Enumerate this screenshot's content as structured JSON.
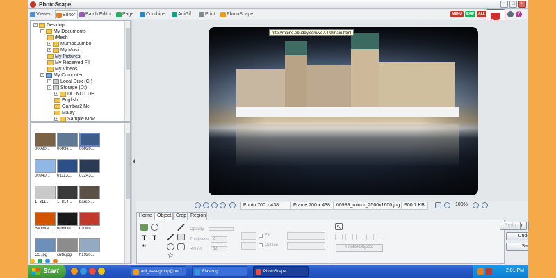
{
  "window": {
    "title": "PhotoScape"
  },
  "tabs": [
    {
      "label": "Viewer",
      "icon": "viewer-icon",
      "color": "#4f8fd6"
    },
    {
      "label": "Editor",
      "icon": "editor-icon",
      "color": "#e67e22",
      "active": true
    },
    {
      "label": "Batch Editor",
      "icon": "batch-editor-icon",
      "color": "#9b59b6"
    },
    {
      "label": "Page",
      "icon": "page-icon",
      "color": "#27ae60"
    },
    {
      "label": "Combine",
      "icon": "combine-icon",
      "color": "#2e86c1"
    },
    {
      "label": "AniGif",
      "icon": "anigif-icon",
      "color": "#16a085"
    },
    {
      "label": "Print",
      "icon": "print-icon",
      "color": "#7f8c8d"
    },
    {
      "label": "PhotoScape",
      "icon": "photoscape-icon",
      "color": "#f39c12"
    }
  ],
  "top_right_badges": [
    {
      "label": "MENU",
      "color": "#c0392b"
    },
    {
      "label": "EXIF",
      "color": "#27ae60"
    },
    {
      "label": "ALL",
      "color": "#c0392b"
    }
  ],
  "tooltip": "http://maine.ebuddy.com/vo7.4.9/main.html",
  "tree": [
    {
      "label": "Desktop",
      "depth": 0,
      "type": "folder",
      "exp": "-"
    },
    {
      "label": "My Documents",
      "depth": 1,
      "type": "folder",
      "exp": "-"
    },
    {
      "label": "iMesh",
      "depth": 2,
      "type": "folder",
      "exp": ""
    },
    {
      "label": "MumboJumbo",
      "depth": 2,
      "type": "folder",
      "exp": "+"
    },
    {
      "label": "My Music",
      "depth": 2,
      "type": "folder",
      "exp": "+"
    },
    {
      "label": "My Pictures",
      "depth": 2,
      "type": "folder",
      "exp": "",
      "selected": true
    },
    {
      "label": "My Received Fil",
      "depth": 2,
      "type": "folder",
      "exp": ""
    },
    {
      "label": "My Videos",
      "depth": 2,
      "type": "folder",
      "exp": ""
    },
    {
      "label": "My Computer",
      "depth": 1,
      "type": "pc",
      "exp": "-"
    },
    {
      "label": "Local Disk (C:)",
      "depth": 2,
      "type": "disk",
      "exp": "+"
    },
    {
      "label": "Storage (D:)",
      "depth": 2,
      "type": "disk",
      "exp": "-"
    },
    {
      "label": "DO NOT DE",
      "depth": 3,
      "type": "folder",
      "exp": "+"
    },
    {
      "label": "English",
      "depth": 3,
      "type": "folder",
      "exp": ""
    },
    {
      "label": "Gambar2 Nc",
      "depth": 3,
      "type": "folder",
      "exp": ""
    },
    {
      "label": "Malay",
      "depth": 3,
      "type": "folder",
      "exp": ""
    },
    {
      "label": "Sample Mov",
      "depth": 3,
      "type": "folder",
      "exp": "+"
    }
  ],
  "thumbnails": [
    {
      "caption": "00930...",
      "color": "#7a6244"
    },
    {
      "caption": "00936...",
      "color": "#5f7894"
    },
    {
      "caption": "00939...",
      "color": "#3e5c88",
      "selected": true
    },
    {
      "caption": "00940...",
      "color": "#8fb8e6"
    },
    {
      "caption": "01113...",
      "color": "#2c4f86"
    },
    {
      "caption": "01243...",
      "color": "#2a3b55"
    },
    {
      "caption": "1_311...",
      "color": "#c9c9c9"
    },
    {
      "caption": "1_814...",
      "color": "#3a3a3a"
    },
    {
      "caption": "barsel...",
      "color": "#5b5147"
    },
    {
      "caption": "BATMA...",
      "color": "#d35400"
    },
    {
      "caption": "bumble...",
      "color": "#1a1a1a"
    },
    {
      "caption": "Clown ...",
      "color": "#c0392b"
    },
    {
      "caption": "CS.jpg",
      "color": "#6d8fb8"
    },
    {
      "caption": "cute.jpg",
      "color": "#8c8c8c"
    },
    {
      "caption": "ff1920...",
      "color": "#94a9c2"
    }
  ],
  "status": {
    "photo": "Photo 700 x 438",
    "frame": "Frame 700 x 438",
    "filename": "00939_mirror_2560x1600.jpg",
    "filesize": "900.7 KB",
    "zoom": "100%"
  },
  "panel_tabs": [
    "Home",
    "Object",
    "Crop",
    "Region"
  ],
  "active_panel_tab": "Object",
  "object_panel": {
    "opacity_label": "Opacity",
    "thickness_label": "Thickness",
    "thickness_value": "2",
    "round_label": "Round",
    "round_value": "32",
    "fill_label": "Fill",
    "outline_label": "Outline",
    "photo_objects_button": "Photo+Objects"
  },
  "right_buttons": {
    "undo": "Undo",
    "redo": "Redo",
    "undo_all": "Undo All",
    "save": "Save"
  },
  "taskbar": {
    "start": "Start",
    "tasks": [
      {
        "label": "adi_wavegroup@hot...",
        "color": "#f39c12"
      },
      {
        "label": "Flashing",
        "color": "#3498db"
      },
      {
        "label": "PhotoScape",
        "color": "#e74c3c",
        "active": true
      }
    ],
    "clock": "2:01 PM"
  }
}
